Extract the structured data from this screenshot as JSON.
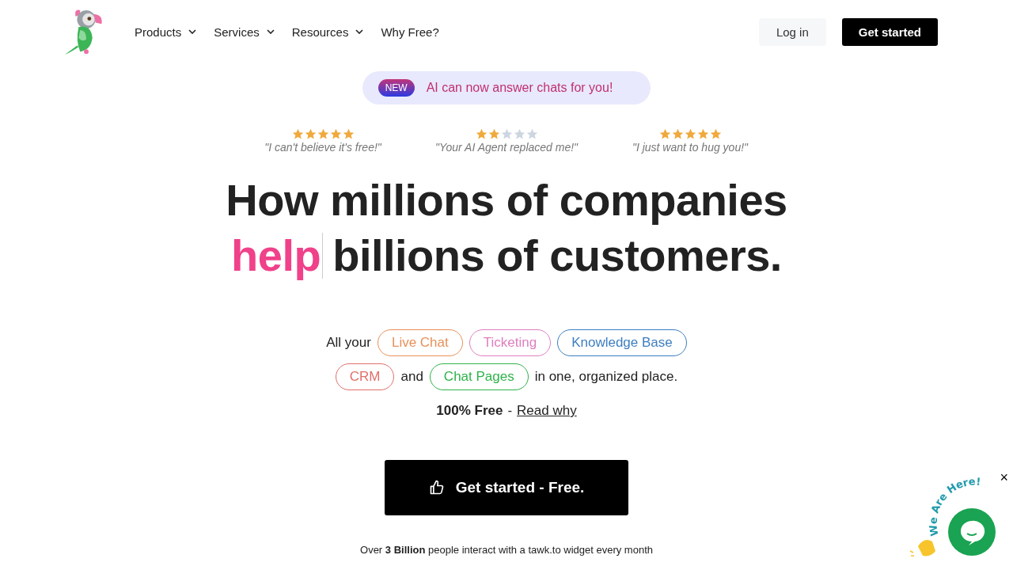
{
  "nav": {
    "items": [
      {
        "label": "Products",
        "dropdown": true
      },
      {
        "label": "Services",
        "dropdown": true
      },
      {
        "label": "Resources",
        "dropdown": true
      },
      {
        "label": "Why Free?",
        "dropdown": false
      }
    ],
    "login": "Log in",
    "cta": "Get started"
  },
  "announcement": {
    "badge": "NEW",
    "text": "AI can now answer chats for you!"
  },
  "reviews": [
    {
      "stars": 5,
      "quote": "\"I can't believe it's free!\""
    },
    {
      "stars": 2,
      "quote": "\"Your AI Agent replaced me!\""
    },
    {
      "stars": 5,
      "quote": "\"I just want to hug you!\""
    }
  ],
  "headline": {
    "line1": "How millions of companies",
    "highlight": "help",
    "rest": "billions of customers."
  },
  "products": [
    [
      {
        "kind": "text",
        "text": "All your"
      },
      {
        "kind": "tag",
        "text": "Live Chat",
        "color": "#e8905a"
      },
      {
        "kind": "tag",
        "text": "Ticketing",
        "color": "#de7fbf"
      },
      {
        "kind": "tag",
        "text": "Knowledge Base",
        "color": "#3d7ec0"
      }
    ],
    [
      {
        "kind": "tag",
        "text": "CRM",
        "color": "#e0706a"
      },
      {
        "kind": "text",
        "text": "and"
      },
      {
        "kind": "tag",
        "text": "Chat Pages",
        "color": "#2fb24a"
      },
      {
        "kind": "text",
        "text": "in one, organized place."
      }
    ]
  ],
  "free": {
    "bold": "100% Free",
    "sep": "-",
    "link": "Read why"
  },
  "main_cta": "Get started - Free.",
  "footnote": "Over **3 Billion** people interact with a tawk.to widget every month",
  "widget": {
    "greeting": "We Are Here!",
    "close": "×"
  }
}
